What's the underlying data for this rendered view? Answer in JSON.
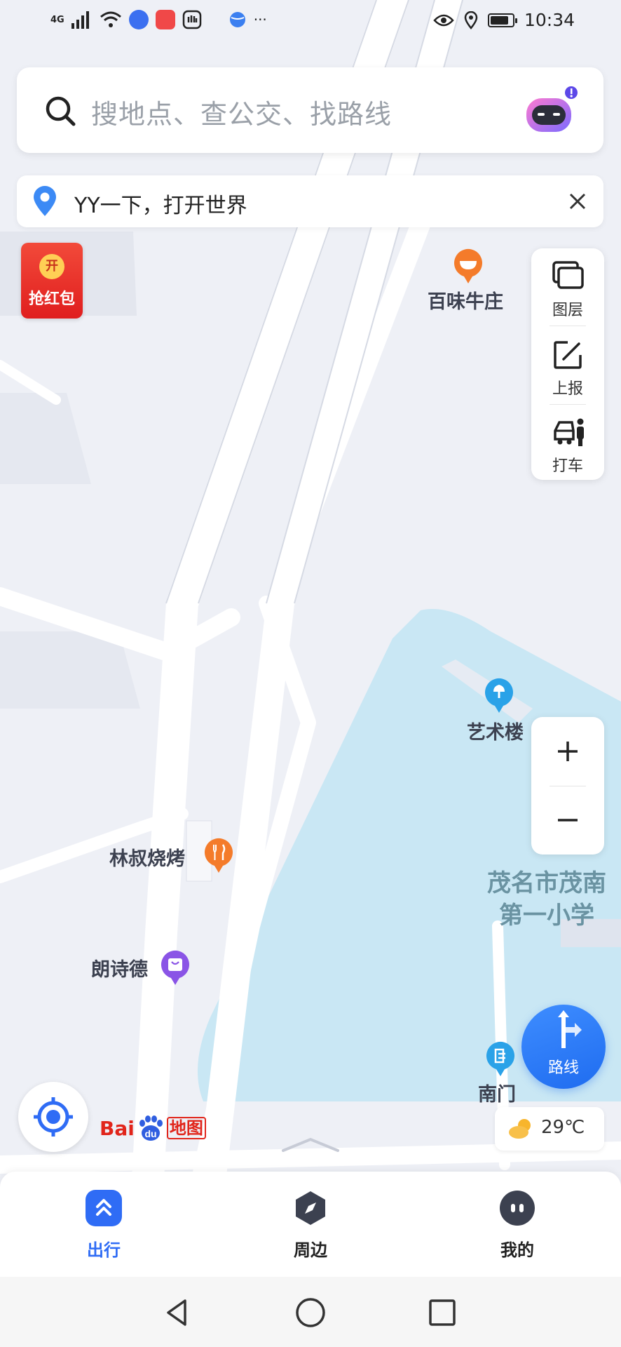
{
  "status_bar": {
    "network": "4G",
    "time": "10:34",
    "battery_fraction": 0.85,
    "more": "···"
  },
  "search": {
    "placeholder": "搜地点、查公交、找路线"
  },
  "notice": {
    "text": "YY一下，打开世界"
  },
  "red_packet": {
    "coin": "开",
    "label": "抢红包"
  },
  "side_tools": [
    {
      "label": "图层",
      "icon": "layers-icon"
    },
    {
      "label": "上报",
      "icon": "report-edit-icon"
    },
    {
      "label": "打车",
      "icon": "taxi-icon"
    }
  ],
  "zoom": {
    "in": "+",
    "out": "−"
  },
  "pois": {
    "restaurant": "百味牛庄",
    "art_building": "艺术楼",
    "bbq": "林叔烧烤",
    "shop": "朗诗德",
    "gate": "南门",
    "school_line1": "茂名市茂南",
    "school_line2": "第一小学"
  },
  "route_button": {
    "label": "路线"
  },
  "logo": {
    "bai": "Bai",
    "du": "du",
    "map": "地图"
  },
  "weather": {
    "temp": "29℃",
    "icon": "cloudy-sun-icon"
  },
  "bottom_nav": [
    {
      "label": "出行",
      "active": true,
      "color": "#2f6cf5"
    },
    {
      "label": "周边",
      "active": false,
      "color": "#222222"
    },
    {
      "label": "我的",
      "active": false,
      "color": "#222222"
    }
  ],
  "colors": {
    "accent": "#2f6cf5",
    "map_bg": "#eef0f6",
    "water": "#c9e7f4",
    "road": "#ffffff",
    "poi_orange": "#f47b2a",
    "poi_blue": "#2aa2e8",
    "poi_purple": "#8a54e6",
    "school_text": "#6a93a2"
  }
}
